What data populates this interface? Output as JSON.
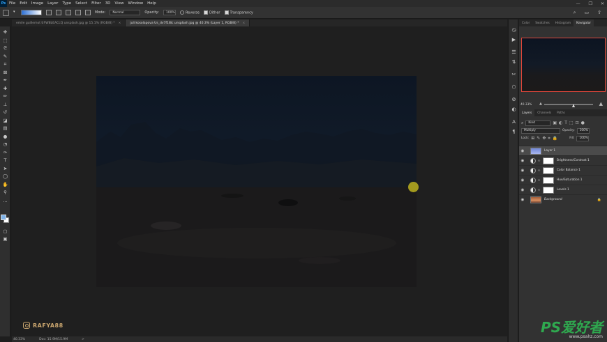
{
  "app": {
    "logo": "Ps"
  },
  "menu": [
    "File",
    "Edit",
    "Image",
    "Layer",
    "Type",
    "Select",
    "Filter",
    "3D",
    "View",
    "Window",
    "Help"
  ],
  "window_controls": [
    "—",
    "❐",
    "✕"
  ],
  "options_bar": {
    "mode_label": "Mode:",
    "mode_value": "Normal",
    "opacity_label": "Opacity:",
    "opacity_value": "100%",
    "reverse_label": "Reverse",
    "dither_label": "Dither",
    "transparency_label": "Transparency",
    "gradient_colors": [
      "#2b6fd6",
      "#ffffff"
    ]
  },
  "doc_tabs": [
    {
      "label": "emile guillemot tIFW8bEACcQ unsplash.jpg @ 15.1% (RGB/8) *",
      "active": false
    },
    {
      "label": "juli kosolapova Us_dv7f1l8c unsplash.jpg @ 40.3% (Layer 1, RGB/8) *",
      "active": true
    }
  ],
  "tools": [
    "move-icon",
    "marquee-icon",
    "lasso-icon",
    "quick-select-icon",
    "crop-icon",
    "frame-icon",
    "eyedropper-icon",
    "healing-icon",
    "brush-icon",
    "stamp-icon",
    "history-brush-icon",
    "eraser-icon",
    "gradient-icon",
    "blur-icon",
    "dodge-icon",
    "pen-icon",
    "type-icon",
    "path-select-icon",
    "ellipse-icon",
    "hand-icon",
    "zoom-icon",
    "more-icon"
  ],
  "colors": {
    "foreground": "#7fb3e8",
    "background": "#ffffff",
    "cursor": "#b3a81f",
    "accent_frame": "#e0463a",
    "logo_green": "#2fa84f"
  },
  "watermark": {
    "handle": "RAFYA88"
  },
  "status": {
    "zoom": "40.33%",
    "doc": "Doc: 15.9M/15.9M",
    "arrow": ">"
  },
  "panels": {
    "top_tabs": [
      {
        "label": "Color",
        "active": false
      },
      {
        "label": "Swatches",
        "active": false
      },
      {
        "label": "Histogram",
        "active": false
      },
      {
        "label": "Navigator",
        "active": true
      }
    ],
    "navigator": {
      "zoom": "40.33%",
      "zoom_level": 0.6
    },
    "layers_tabs": [
      {
        "label": "Layers",
        "active": true
      },
      {
        "label": "Channels",
        "active": false
      },
      {
        "label": "Paths",
        "active": false
      }
    ],
    "kind_label": "Kind",
    "blend_mode": "Multiply",
    "opacity_label": "Opacity:",
    "opacity_value": "100%",
    "lock_label": "Lock:",
    "fill_label": "Fill:",
    "fill_value": "100%",
    "layers": [
      {
        "name": "Layer 1",
        "type": "pixel",
        "selected": true,
        "thumb": "blue"
      },
      {
        "name": "Brightness/Contrast 1",
        "type": "adjustment",
        "selected": false,
        "thumb": "white"
      },
      {
        "name": "Color Balance 1",
        "type": "adjustment",
        "selected": false,
        "thumb": "white"
      },
      {
        "name": "Hue/Saturation 1",
        "type": "adjustment",
        "selected": false,
        "thumb": "white"
      },
      {
        "name": "Levels 1",
        "type": "adjustment",
        "selected": false,
        "thumb": "white"
      },
      {
        "name": "Background",
        "type": "background",
        "selected": false,
        "thumb": "photo"
      }
    ]
  },
  "site_logo": {
    "big": "PS爱好者",
    "small": "www.psahz.com"
  }
}
